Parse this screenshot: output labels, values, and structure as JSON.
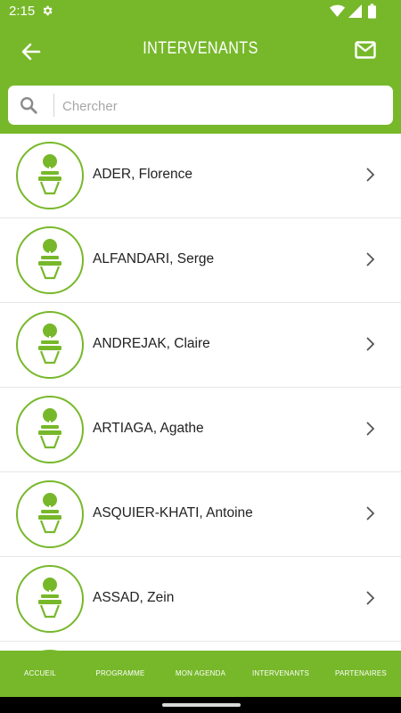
{
  "status_bar": {
    "time": "2:15"
  },
  "app_bar": {
    "title": "INTERVENANTS"
  },
  "search": {
    "placeholder": "Chercher",
    "value": ""
  },
  "speakers": [
    {
      "name": "ADER, Florence"
    },
    {
      "name": "ALFANDARI, Serge"
    },
    {
      "name": "ANDREJAK, Claire"
    },
    {
      "name": "ARTIAGA, Agathe"
    },
    {
      "name": "ASQUIER-KHATI, Antoine"
    },
    {
      "name": "ASSAD, Zein"
    },
    {
      "name": ""
    }
  ],
  "bottom_nav": [
    {
      "label": "ACCUEIL"
    },
    {
      "label": "PROGRAMME"
    },
    {
      "label": "MON AGENDA"
    },
    {
      "label": "INTERVENANTS"
    },
    {
      "label": "PARTENAIRES"
    }
  ],
  "colors": {
    "accent": "#77b82a"
  }
}
